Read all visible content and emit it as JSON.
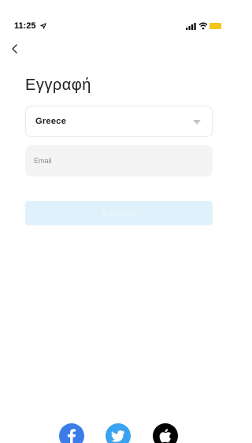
{
  "status_bar": {
    "time": "11:25"
  },
  "icons": {
    "back": "chevron-left-icon",
    "location": "location-arrow-icon",
    "signal": "cellular-signal-icon",
    "wifi": "wifi-icon",
    "battery": "battery-icon",
    "dropdown": "caret-down-icon",
    "facebook": "facebook-icon",
    "twitter": "twitter-icon",
    "apple": "apple-icon"
  },
  "colors": {
    "accent_disabled": "#dff2fb",
    "facebook": "#3b7ce8",
    "twitter": "#3aa3f0",
    "apple": "#000000",
    "battery": "#f5c518"
  },
  "page": {
    "title": "Εγγραφή"
  },
  "form": {
    "country": {
      "value": "Greece"
    },
    "email": {
      "value": "",
      "placeholder": "Email"
    },
    "submit": {
      "label": "Συνέχεια",
      "enabled": false
    }
  }
}
